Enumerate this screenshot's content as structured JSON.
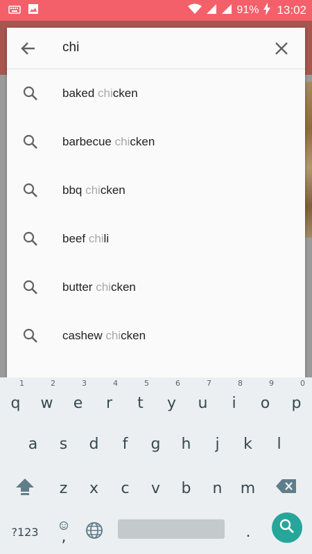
{
  "status_bar": {
    "battery_percent": "91%",
    "clock": "13:02",
    "icons": [
      "keyboard-icon",
      "image-icon",
      "wifi-icon",
      "signal-icon",
      "signal-icon",
      "charging-icon"
    ]
  },
  "search": {
    "query": "chi",
    "back_icon": "arrow-left-icon",
    "clear_icon": "close-icon"
  },
  "suggestions": [
    {
      "before": "baked ",
      "match": "chi",
      "after": "cken"
    },
    {
      "before": "barbecue ",
      "match": "chi",
      "after": "cken"
    },
    {
      "before": "bbq ",
      "match": "chi",
      "after": "cken"
    },
    {
      "before": "beef ",
      "match": "chi",
      "after": "li"
    },
    {
      "before": "butter ",
      "match": "chi",
      "after": "cken"
    },
    {
      "before": "cashew ",
      "match": "chi",
      "after": "cken"
    }
  ],
  "keyboard": {
    "row1": [
      {
        "letter": "q",
        "hint": "1"
      },
      {
        "letter": "w",
        "hint": "2"
      },
      {
        "letter": "e",
        "hint": "3"
      },
      {
        "letter": "r",
        "hint": "4"
      },
      {
        "letter": "t",
        "hint": "5"
      },
      {
        "letter": "y",
        "hint": "6"
      },
      {
        "letter": "u",
        "hint": "7"
      },
      {
        "letter": "i",
        "hint": "8"
      },
      {
        "letter": "o",
        "hint": "9"
      },
      {
        "letter": "p",
        "hint": "0"
      }
    ],
    "row2": [
      "a",
      "s",
      "d",
      "f",
      "g",
      "h",
      "j",
      "k",
      "l"
    ],
    "row3": [
      "z",
      "x",
      "c",
      "v",
      "b",
      "n",
      "m"
    ],
    "symbols_label": "?123",
    "comma": ",",
    "period": "."
  },
  "colors": {
    "status_bar": "#f4606a",
    "accent": "#26a69a",
    "keyboard_bg": "#eceff1",
    "match_text": "#a8a8a8"
  }
}
